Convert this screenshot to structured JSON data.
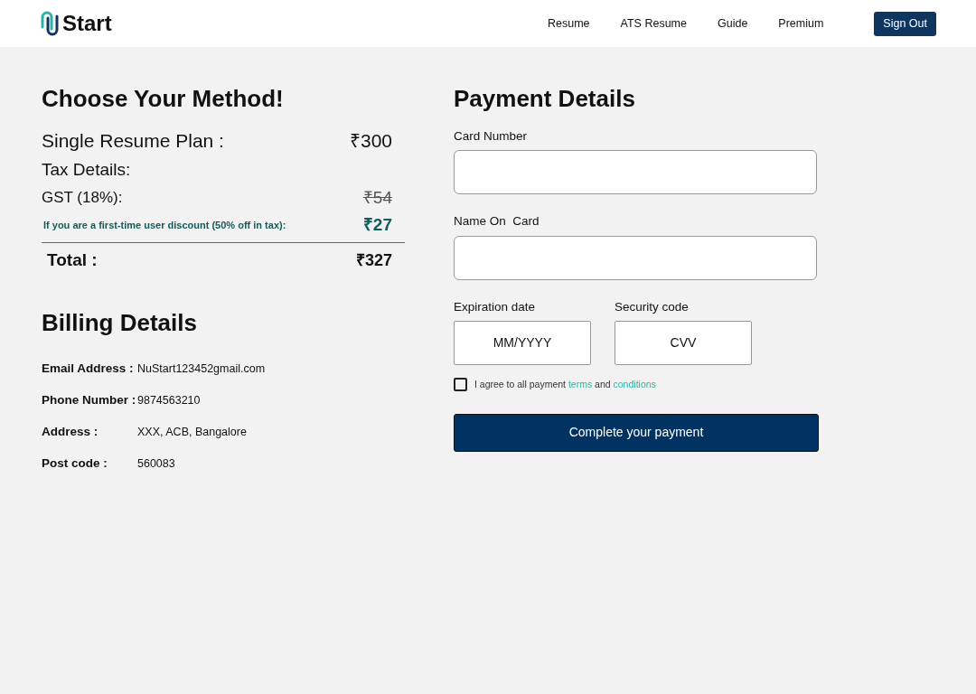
{
  "header": {
    "logo_text": "Start",
    "nav": [
      "Resume",
      "ATS Resume",
      "Guide",
      "Premium"
    ],
    "sign_out": "Sign Out"
  },
  "method": {
    "title": "Choose Your Method!",
    "rows": [
      {
        "kind": "plan",
        "label": "Single Resume Plan :",
        "amount": "₹300",
        "struck": false
      },
      {
        "kind": "heading",
        "label": "Tax Details:"
      },
      {
        "kind": "tax",
        "label": "GST (18%):",
        "amount": "₹54",
        "struck": true
      },
      {
        "kind": "discount",
        "label": "If you are a first-time user discount (50% off in tax):",
        "amount": "₹27",
        "struck": false
      }
    ],
    "total_label": "Total :",
    "total_amount": "₹327"
  },
  "billing": {
    "title": "Billing Details",
    "rows": [
      {
        "label": "Email Address :",
        "value": "NuStart123452gmail.com"
      },
      {
        "label": "Phone Number :",
        "value": "9874563210"
      },
      {
        "label": "Address :",
        "value": "XXX, ACB, Bangalore"
      },
      {
        "label": "Post code :",
        "value": "560083"
      }
    ]
  },
  "payment": {
    "title": "Payment Details",
    "card_number": {
      "label": "Card Number"
    },
    "name_on_card": {
      "label": "Name On  Card"
    },
    "expiration": {
      "label": "Expiration date",
      "placeholder": "MM/YYYY"
    },
    "security": {
      "label": "Security code",
      "placeholder": "CVV"
    },
    "agree": {
      "checked": false,
      "text": "I agree to all payment",
      "terms": "terms",
      "and": "and",
      "conditions": "conditions"
    },
    "submit": "Complete your payment"
  }
}
